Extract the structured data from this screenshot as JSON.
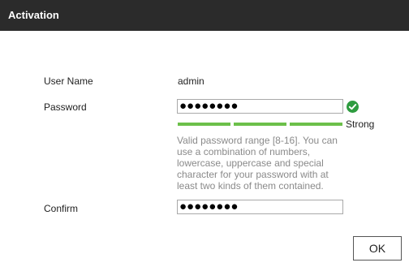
{
  "dialog": {
    "title": "Activation",
    "ok_label": "OK"
  },
  "form": {
    "username_label": "User Name",
    "username_value": "admin",
    "password_label": "Password",
    "password_value": "●●●●●●●●",
    "password_valid_icon": "check-circle-icon",
    "strength_segments_filled": 3,
    "strength_segments_total": 3,
    "strength_label": "Strong",
    "hint": "Valid password range [8-16]. You can use a combination of numbers, lowercase, uppercase and special character for your password with at least two kinds of them contained.",
    "confirm_label": "Confirm",
    "confirm_value": "●●●●●●●●"
  },
  "colors": {
    "titlebar": "#2b2b2b",
    "strength_bar": "#6cc04a",
    "valid_icon": "#2e9c3f",
    "hint_text": "#8a8a8a"
  }
}
